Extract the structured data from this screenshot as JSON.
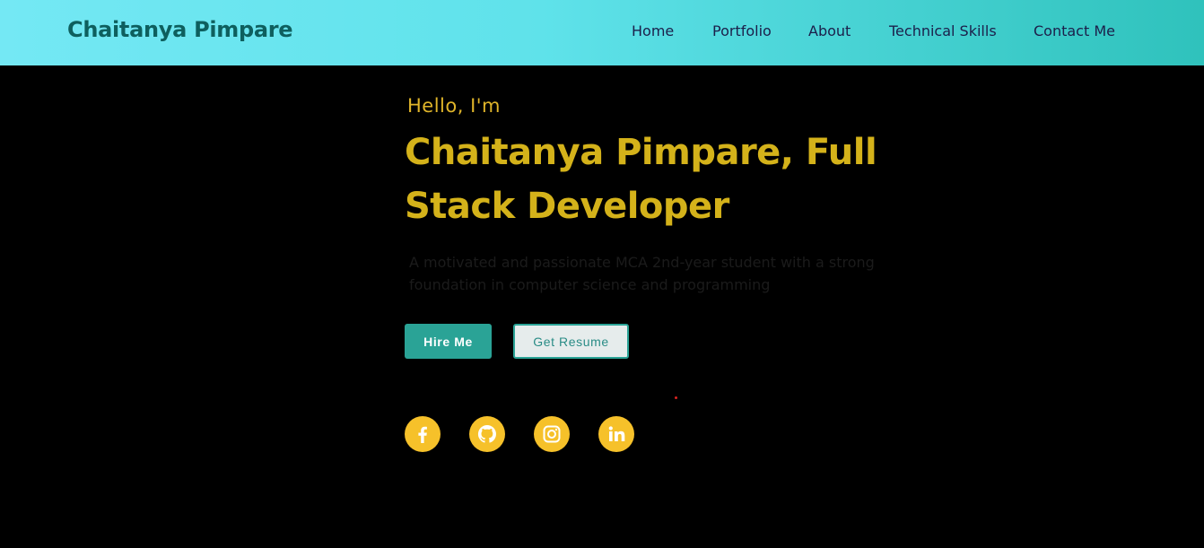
{
  "header": {
    "brand": "Chaitanya Pimpare",
    "nav": [
      {
        "label": "Home"
      },
      {
        "label": "Portfolio"
      },
      {
        "label": "About"
      },
      {
        "label": "Technical Skills"
      },
      {
        "label": "Contact Me"
      }
    ]
  },
  "hero": {
    "greeting": "Hello, I'm",
    "headline": "Chaitanya Pimpare, Full Stack Developer",
    "tagline": "A motivated and passionate MCA 2nd-year student with a strong foundation in computer science and programming",
    "buttons": {
      "hire": "Hire Me",
      "resume": "Get Resume"
    },
    "social_icons": [
      "facebook-icon",
      "github-icon",
      "instagram-icon",
      "linkedin-icon"
    ]
  },
  "colors": {
    "nav_gradient_start": "#74e8f4",
    "nav_gradient_end": "#2fc2bc",
    "brand_text": "#0e5f5e",
    "headline": "#d4b21a",
    "accent": "#2aa396",
    "social_bg": "#f6c12a",
    "background": "#000000"
  }
}
